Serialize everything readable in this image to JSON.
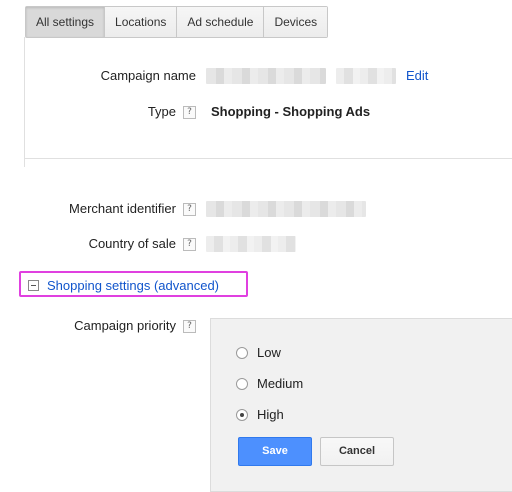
{
  "tabs": [
    {
      "label": "All settings",
      "active": true
    },
    {
      "label": "Locations"
    },
    {
      "label": "Ad schedule"
    },
    {
      "label": "Devices"
    }
  ],
  "campaign": {
    "name_label": "Campaign name",
    "edit_label": "Edit",
    "type_label": "Type",
    "type_value": "Shopping - Shopping Ads"
  },
  "merchant": {
    "identifier_label": "Merchant identifier",
    "country_label": "Country of sale"
  },
  "shopping": {
    "section_label": "Shopping settings (advanced)",
    "priority_label": "Campaign priority",
    "options": [
      "Low",
      "Medium",
      "High"
    ],
    "selected": "High",
    "save_label": "Save",
    "cancel_label": "Cancel"
  },
  "help_glyph": "?",
  "colors": {
    "link": "#1155cc",
    "primary_button": "#4d90fe",
    "highlight": "#e040e0"
  }
}
